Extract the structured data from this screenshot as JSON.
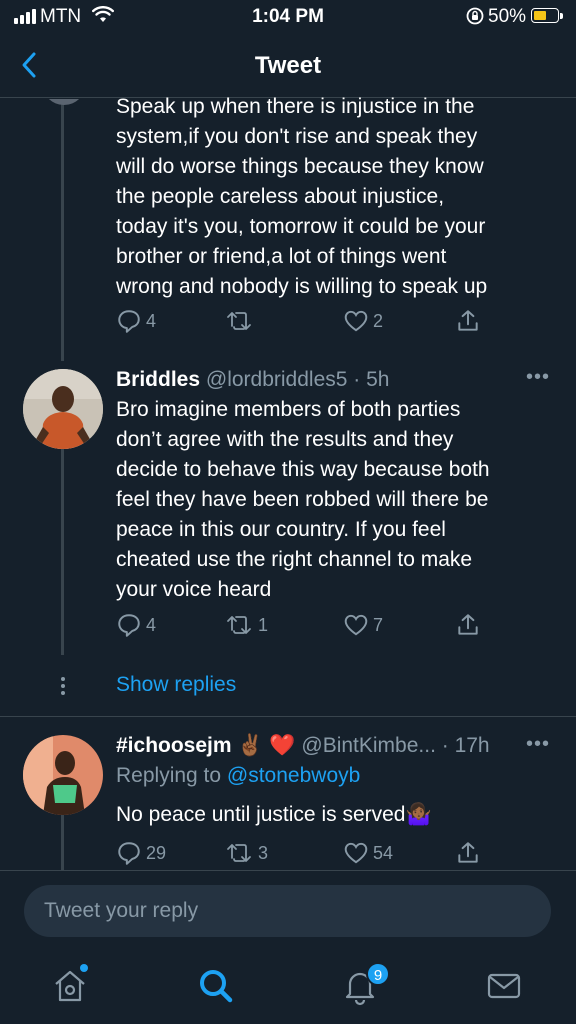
{
  "status_bar": {
    "carrier": "MTN",
    "time": "1:04 PM",
    "battery_percent": "50%",
    "battery_level": 0.5
  },
  "header": {
    "title": "Tweet"
  },
  "tweet1": {
    "lines": [
      "Speak up when there is injustice in the",
      "system,if you don't rise and speak they",
      "will do worse things because they know",
      "the people careless about injustice,",
      "today it's you, tomorrow it could be your",
      "brother or friend,a lot of things went",
      "wrong and nobody is willing to speak up"
    ],
    "replies": "4",
    "retweets": "",
    "likes": "2"
  },
  "tweet2": {
    "name": "Briddles",
    "handle_time": "@lordbriddles5 · 5h",
    "lines": [
      "Bro imagine members of both parties",
      "don’t agree with the results and they",
      "decide to behave this way because both",
      "feel they have been robbed will there be",
      "peace in this our country. If you feel",
      "cheated use the right channel to make",
      "your voice heard"
    ],
    "replies": "4",
    "retweets": "1",
    "likes": "7",
    "show_replies": "Show replies"
  },
  "tweet3": {
    "name": "#ichoosejm",
    "name_emoji": "✌🏾 ❤️",
    "handle_time": "@BintKimbe... · 17h",
    "replying_label": "Replying to",
    "replying_mention": "@stonebwoyb",
    "text": "No peace until justice is served",
    "text_emoji": "🤷🏾‍♀️",
    "replies": "29",
    "retweets": "3",
    "likes": "54"
  },
  "compose": {
    "placeholder": "Tweet your reply"
  },
  "tabbar": {
    "notifications_badge": "9"
  },
  "colors": {
    "background": "#15202b",
    "accent": "#1da1f2",
    "muted": "#8899a6",
    "divider": "#38444d",
    "battery": "#f5c518"
  }
}
